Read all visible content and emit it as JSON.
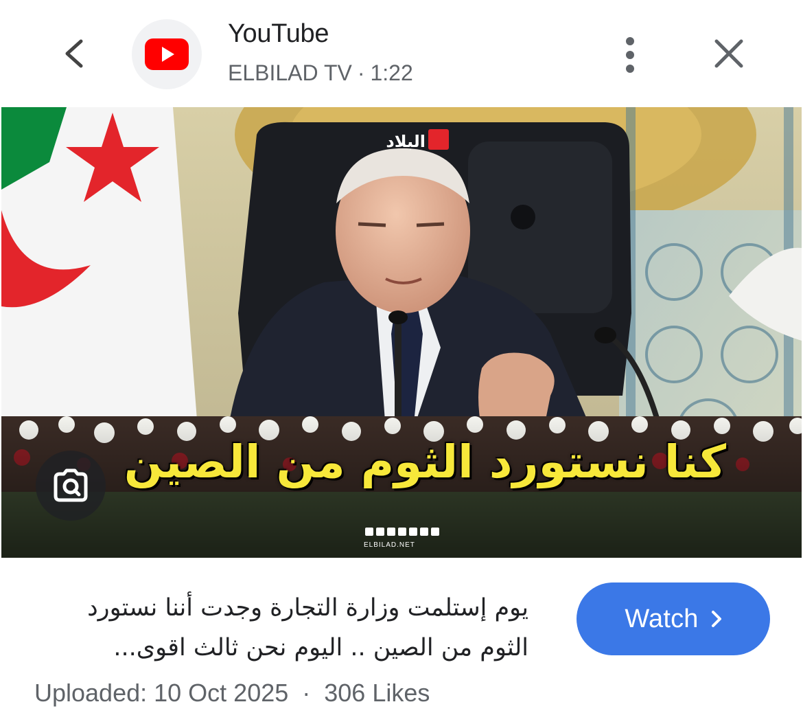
{
  "header": {
    "app_name": "YouTube",
    "channel": "ELBILAD TV",
    "separator": "·",
    "duration": "1:22"
  },
  "media": {
    "channel_logo_text": "البلاد",
    "caption": "كنا نستورد الثوم من الصين",
    "watermark": "ELBILAD.NET"
  },
  "result": {
    "title_line1": "يوم إستلمت وزارة التجارة وجدت أننا نستورد",
    "title_line2": "الثوم من الصين .. اليوم نحن ثالث اقوى...",
    "watch_label": "Watch",
    "uploaded": "Uploaded: 10 Oct 2025",
    "meta_separator": "·",
    "likes": "306 Likes"
  },
  "icons": {
    "back": "chevron-left-icon",
    "app": "youtube-logo-icon",
    "more": "more-vert-icon",
    "close": "close-icon",
    "lens": "google-lens-icon",
    "watch": "chevron-right-icon"
  },
  "colors": {
    "youtube_red": "#ff0000",
    "watch_blue": "#3b78e7",
    "caption_yellow": "#f7e83a"
  }
}
